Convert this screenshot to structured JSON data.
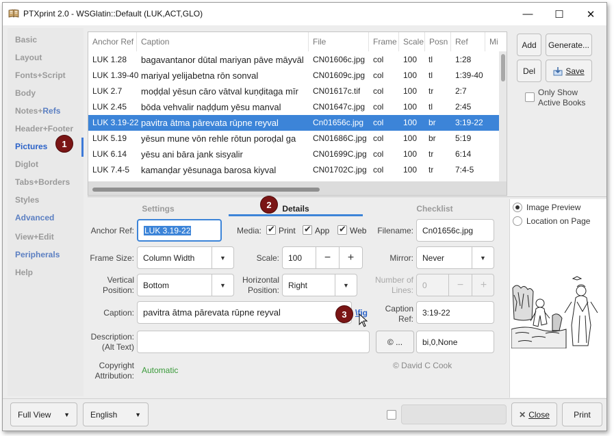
{
  "window": {
    "title": "PTXprint 2.0  -  WSGlatin::Default  (LUK,ACT,GLO)",
    "minimize": "—",
    "maximize": "☐",
    "close": "✕"
  },
  "sidebar": {
    "items": [
      {
        "label": "Basic"
      },
      {
        "label": "Layout"
      },
      {
        "label": "Fonts+Script"
      },
      {
        "label": "Body"
      },
      {
        "label": "Notes+",
        "label2": "Refs"
      },
      {
        "label": "Header+Footer"
      },
      {
        "label": "Pictures"
      },
      {
        "label": "Diglot"
      },
      {
        "label": "Tabs+Borders"
      },
      {
        "label": "Styles"
      },
      {
        "label": "Advanced"
      },
      {
        "label": "View+Edit"
      },
      {
        "label": "Peripherals"
      },
      {
        "label": "Help"
      }
    ]
  },
  "badges": {
    "one": "1",
    "two": "2",
    "three": "3"
  },
  "table": {
    "columns": [
      "Anchor Ref",
      "Caption",
      "File",
      "Frame",
      "Scale",
      "Posn",
      "Ref",
      "Mi"
    ],
    "rows": [
      {
        "anchor": "LUK 1.28",
        "caption": "bagavantanor dūtal mariyan pāve māyvāl",
        "file": "CN01606c.jpg",
        "frame": "col",
        "scale": "100",
        "posn": "tl",
        "ref": "1:28"
      },
      {
        "anchor": "LUK 1.39-40",
        "caption": "mariyal yelijabetna rōn sonval",
        "file": "CN01609c.jpg",
        "frame": "col",
        "scale": "100",
        "posn": "tl",
        "ref": "1:39-40"
      },
      {
        "anchor": "LUK 2.7",
        "caption": "moḍḍal yēsun cāro vātval kuṇḍitaga mīr",
        "file": "CN01617c.tif",
        "frame": "col",
        "scale": "100",
        "posn": "tr",
        "ref": "2:7"
      },
      {
        "anchor": "LUK 2.45",
        "caption": "bōda vehvalir naḍḍum yēsu manval",
        "file": "CN01647c.jpg",
        "frame": "col",
        "scale": "100",
        "posn": "tl",
        "ref": "2:45"
      },
      {
        "anchor": "LUK 3.19-22",
        "caption": "pavitra ātma pārevata rūpne reyval",
        "file": "Cn01656c.jpg",
        "frame": "col",
        "scale": "100",
        "posn": "br",
        "ref": "3:19-22"
      },
      {
        "anchor": "LUK 5.19",
        "caption": "yēsun mune vōn rehle rōtun poroḍal ga",
        "file": "CN01686C.jpg",
        "frame": "col",
        "scale": "100",
        "posn": "br",
        "ref": "5:19"
      },
      {
        "anchor": "LUK 6.14",
        "caption": "yēsu ani bāra jank sisyalir",
        "file": "CN01699C.jpg",
        "frame": "col",
        "scale": "100",
        "posn": "tr",
        "ref": "6:14"
      },
      {
        "anchor": "LUK 7.4-5",
        "caption": "kamanḍar yēsunaga barosa kiyval",
        "file": "CN01702C.jpg",
        "frame": "col",
        "scale": "100",
        "posn": "tr",
        "ref": "7:4-5"
      }
    ]
  },
  "right_buttons": {
    "add": "Add",
    "generate": "Generate...",
    "del": "Del",
    "save": "Save",
    "only_show": "Only Show",
    "active_books": "Active Books"
  },
  "tabs": {
    "settings": "Settings",
    "details": "Details",
    "checklist": "Checklist"
  },
  "form": {
    "anchor_ref_label": "Anchor Ref:",
    "anchor_ref_value": "LUK 3.19-22",
    "media_label": "Media:",
    "media_print": "Print",
    "media_app": "App",
    "media_web": "Web",
    "filename_label": "Filename:",
    "filename_value": "Cn01656c.jpg",
    "frame_size_label": "Frame Size:",
    "frame_size_value": "Column Width",
    "scale_label": "Scale:",
    "scale_value": "100",
    "mirror_label": "Mirror:",
    "mirror_value": "Never",
    "vpos_label_1": "Vertical",
    "vpos_label_2": "Position:",
    "vpos_value": "Bottom",
    "hpos_label_1": "Horizontal",
    "hpos_label_2": "Position:",
    "hpos_value": "Right",
    "lines_label_1": "Number of",
    "lines_label_2": "Lines:",
    "lines_value": "0",
    "caption_label": "Caption:",
    "caption_value": "pavitra ātma pārevata rūpne reyval",
    "fig_link": "\\fig",
    "caption_ref_label_1": "Caption",
    "caption_ref_label_2": "Ref:",
    "caption_ref_value": "3:19-22",
    "desc_label_1": "Description:",
    "desc_label_2": "(Alt Text)",
    "desc_value": "",
    "copyright_button": "© ...",
    "copyright_code": "bi,0,None",
    "copyright_label_1": "Copyright",
    "copyright_label_2": "Attribution:",
    "copyright_value": "Automatic",
    "copyright_text": "© David C Cook"
  },
  "preview": {
    "image_preview": "Image Preview",
    "location_on_page": "Location on Page"
  },
  "bottom": {
    "view": "Full View",
    "language": "English",
    "close": "Close",
    "print": "Print"
  },
  "colors": {
    "accent": "#3c84d8",
    "badge": "#7a1515",
    "link": "#2b62c8",
    "green": "#3a9a3a"
  }
}
